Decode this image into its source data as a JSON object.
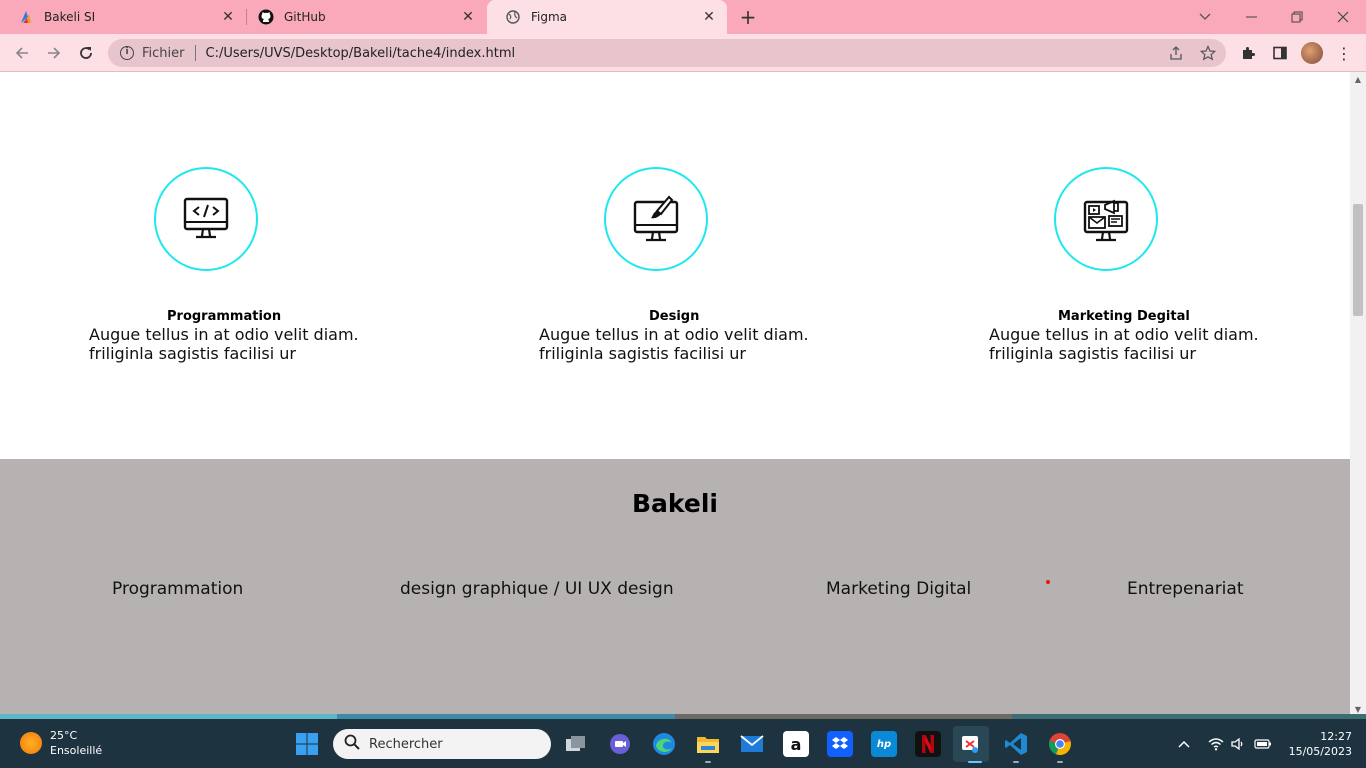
{
  "browser": {
    "tabs": [
      {
        "title": "Bakeli SI",
        "active": false
      },
      {
        "title": "GitHub",
        "active": false
      },
      {
        "title": "Figma",
        "active": true
      }
    ],
    "new_tab": "+",
    "address": {
      "scheme_label": "Fichier",
      "url": "C:/Users/UVS/Desktop/Bakeli/tache4/index.html"
    }
  },
  "services": [
    {
      "icon": "code-monitor-icon",
      "title": "Programmation",
      "line1": "Augue tellus in at odio velit diam.",
      "line2": "friliginla sagistis facilisi ur"
    },
    {
      "icon": "design-monitor-icon",
      "title": "Design",
      "line1": "Augue tellus in at odio velit diam.",
      "line2": "friliginla sagistis facilisi ur"
    },
    {
      "icon": "marketing-monitor-icon",
      "title": "Marketing Degital",
      "line1": "Augue tellus in at odio velit diam.",
      "line2": "friliginla sagistis facilisi ur"
    }
  ],
  "footer": {
    "title": "Bakeli",
    "links": [
      "Programmation",
      "design graphique / UI UX design",
      "Marketing Digital",
      "Entrepenariat"
    ]
  },
  "taskbar": {
    "weather": {
      "temp": "25°C",
      "condition": "Ensoleillé"
    },
    "search_placeholder": "Rechercher",
    "time": "12:27",
    "date": "15/05/2023"
  },
  "colors": {
    "tab_bar": "#f9a9b9",
    "ring": "#1ee8ee",
    "footer_bg": "#b5b2b1",
    "taskbar": "#1e3340"
  }
}
